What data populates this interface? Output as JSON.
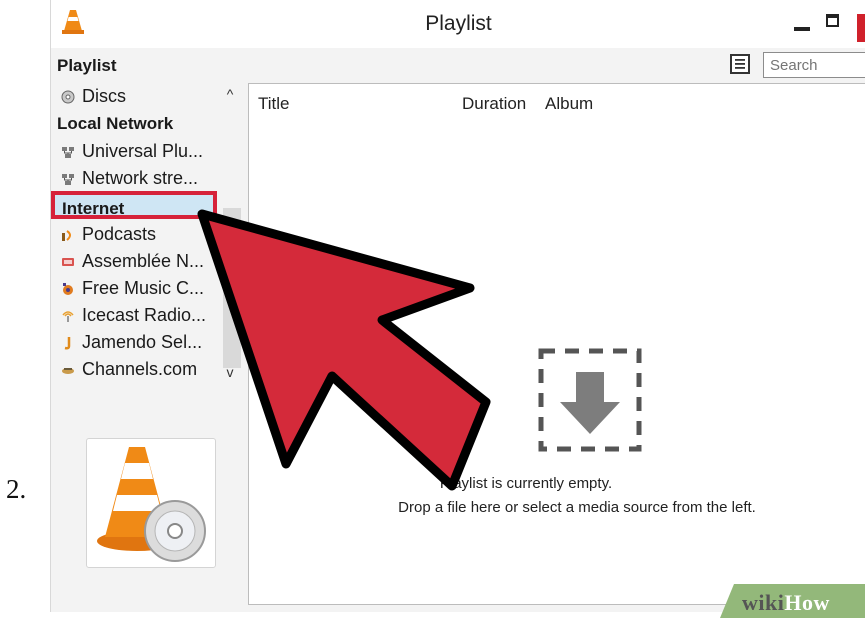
{
  "step_number": "2.",
  "window": {
    "title": "Playlist"
  },
  "sidebar": {
    "header": "Playlist",
    "items": [
      {
        "label": "Discs",
        "icon": "disc-icon"
      },
      {
        "label": "Universal Plu...",
        "icon": "network-icon"
      },
      {
        "label": "Network stre...",
        "icon": "network-icon"
      },
      {
        "label": "Podcasts",
        "icon": "podcast-icon"
      },
      {
        "label": "Assemblée N...",
        "icon": "tv-icon"
      },
      {
        "label": "Free Music C...",
        "icon": "music-icon"
      },
      {
        "label": "Icecast Radio...",
        "icon": "radio-icon"
      },
      {
        "label": "Jamendo Sel...",
        "icon": "jamendo-icon"
      },
      {
        "label": "Channels.com",
        "icon": "channels-icon"
      }
    ],
    "groups": {
      "local_network": "Local Network",
      "internet": "Internet"
    }
  },
  "search": {
    "placeholder": "Search"
  },
  "columns": [
    "Title",
    "Duration",
    "Album"
  ],
  "empty_state": {
    "line1": "Playlist is currently empty.",
    "line2": "Drop a file here or select a media source from the left."
  },
  "watermark": {
    "part1": "wiki",
    "part2": "How"
  },
  "colors": {
    "highlight_border": "#d6223a",
    "selected_bg": "#cfe6f4",
    "arrow_fill": "#d42a3a",
    "close_button": "#d0212b",
    "cone_orange": "#f08a16"
  }
}
